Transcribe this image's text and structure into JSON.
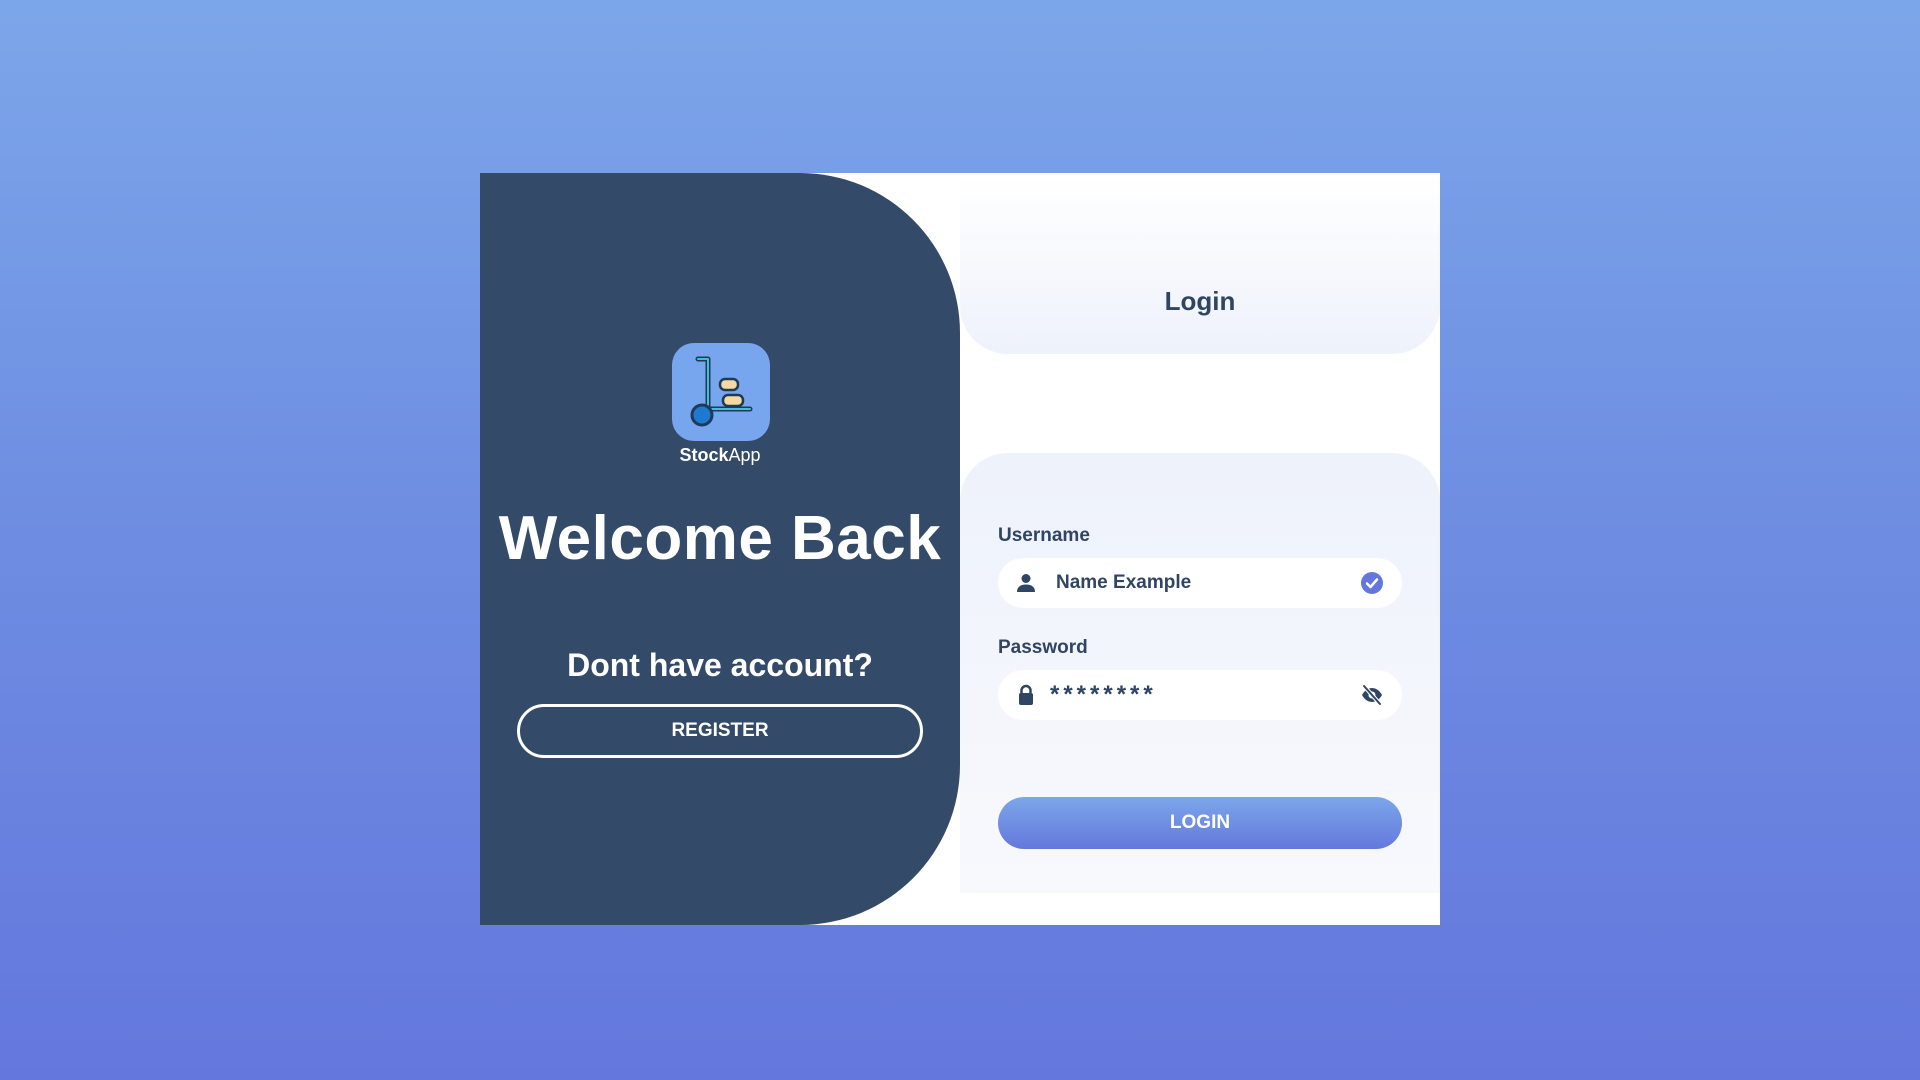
{
  "brand": {
    "name_bold": "Stock",
    "name_regular": "App",
    "logo_icon": "hand-truck-icon"
  },
  "left_panel": {
    "heading": "Welcome Back",
    "prompt": "Dont have account?",
    "register_label": "REGISTER"
  },
  "login": {
    "title": "Login",
    "username": {
      "label": "Username",
      "value": "Name Example",
      "icon": "user-icon",
      "status_icon": "check-circle-icon"
    },
    "password": {
      "label": "Password",
      "value": "********",
      "icon": "lock-icon",
      "toggle_icon": "eye-off-icon"
    },
    "submit_label": "LOGIN"
  },
  "colors": {
    "background_top": "#7ca6ea",
    "background_bottom": "#6477dd",
    "left_panel": "#334a68",
    "text_dark": "#2f4563",
    "check_accent": "#6477dd"
  }
}
